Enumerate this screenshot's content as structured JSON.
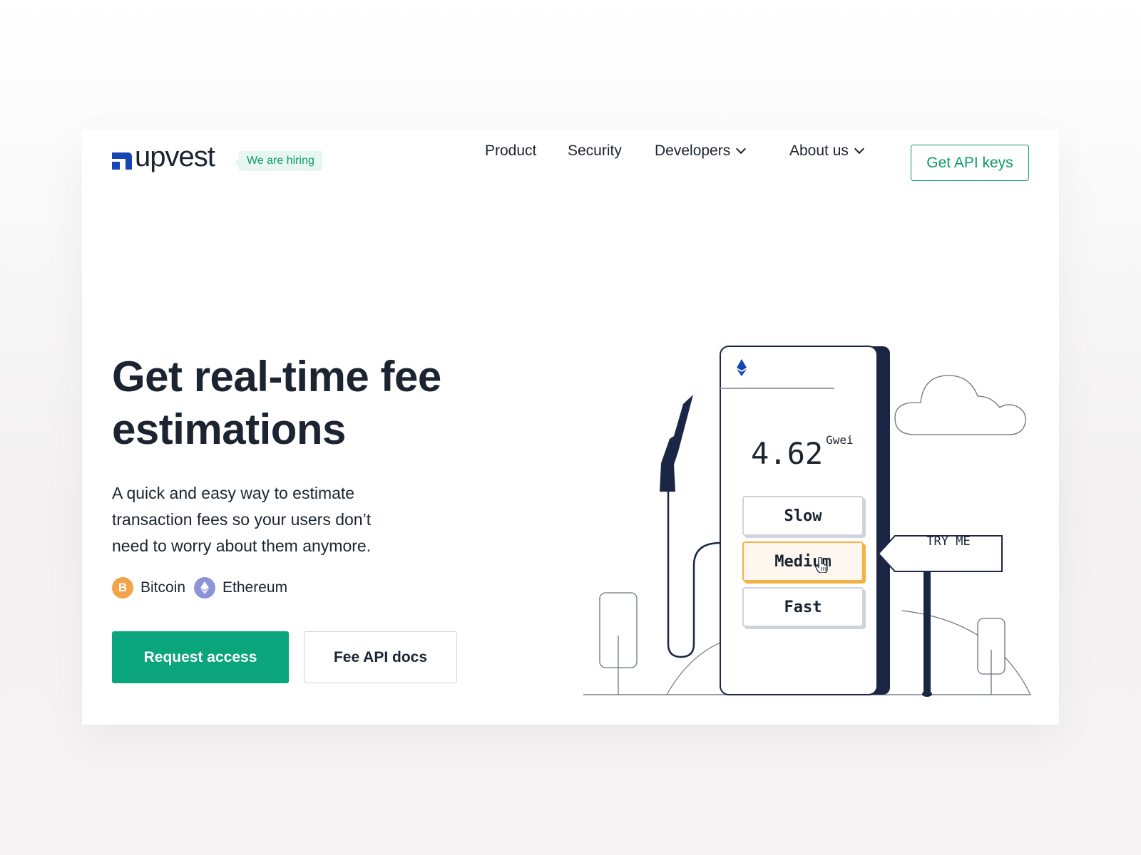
{
  "header": {
    "brand": "upvest",
    "hiring_badge": "We are hiring",
    "nav": [
      {
        "label": "Product",
        "has_dropdown": false
      },
      {
        "label": "Security",
        "has_dropdown": false
      },
      {
        "label": "Developers",
        "has_dropdown": true
      },
      {
        "label": "About us",
        "has_dropdown": true
      }
    ],
    "cta": "Get API keys"
  },
  "hero": {
    "title_line1": "Get real-time fee",
    "title_line2": "estimations",
    "lead_line1": "A quick and easy way to estimate",
    "lead_line2": "transaction fees so your users don’t",
    "lead_line3": "need to worry about them anymore.",
    "coins": [
      {
        "label": "Bitcoin",
        "icon": "bitcoin-icon",
        "glyph": "B",
        "color": "#f0a54a"
      },
      {
        "label": "Ethereum",
        "icon": "ethereum-icon",
        "glyph": "◆",
        "color": "#8c93d8"
      }
    ],
    "primary_button": "Request access",
    "secondary_button": "Fee API docs"
  },
  "illustration": {
    "fee_value": "4.62",
    "fee_unit": "Gwei",
    "speed_options": [
      {
        "label": "Slow",
        "selected": false
      },
      {
        "label": "Medium",
        "selected": true
      },
      {
        "label": "Fast",
        "selected": false
      }
    ],
    "sign_label": "TRY ME"
  },
  "colors": {
    "accent_green": "#0aa57c",
    "brand_blue": "#1646b4",
    "navy": "#1b2644",
    "selected_orange": "#f6b144"
  }
}
